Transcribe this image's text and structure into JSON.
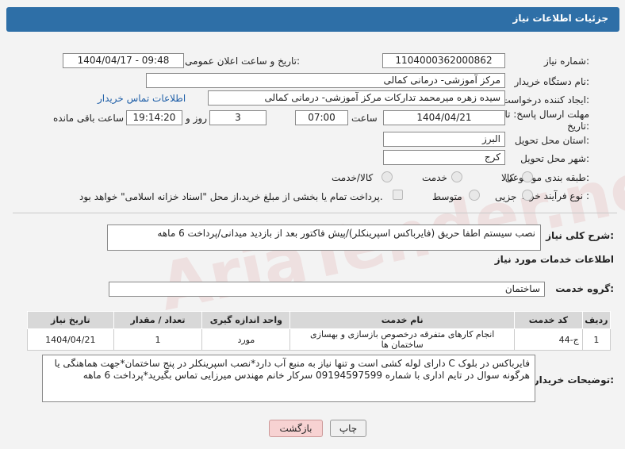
{
  "header": {
    "title": "جزئیات اطلاعات نیاز"
  },
  "fields": {
    "need_number_label": "شماره نیاز:",
    "need_number": "1104000362000862",
    "announce_label": "تاریخ و ساعت اعلان عمومی:",
    "announce_value": "1404/04/17 - 09:48",
    "buyer_org_label": "نام دستگاه خریدار:",
    "buyer_org": "مرکز آموزشی- درمانی کمالی",
    "creator_label": "ایجاد کننده درخواست:",
    "creator": "سیده زهره میرمحمد تدارکات مرکز آموزشی- درمانی کمالی",
    "buyer_contact_link": "اطلاعات تماس خریدار",
    "deadline_label_1": "مهلت ارسال پاسخ: تا",
    "deadline_label_2": "تاریخ:",
    "deadline_date": "1404/04/21",
    "time_label": "ساعت",
    "deadline_time": "07:00",
    "days_value": "3",
    "days_label": "روز و",
    "remaining_time": "19:14:20",
    "remaining_label": "ساعت باقی مانده",
    "province_label": "استان محل تحویل:",
    "province": "البرز",
    "city_label": "شهر محل تحویل:",
    "city": "کرج",
    "category_label": "طبقه بندی موضوعی:",
    "category_options": [
      "کالا",
      "خدمت",
      "کالا/خدمت"
    ],
    "process_label": "نوع فرآیند خرید :",
    "process_options": [
      "جزیی",
      "متوسط"
    ],
    "payment_note": "پرداخت تمام یا بخشی از مبلغ خرید،از محل \"اسناد خزانه اسلامی\" خواهد بود."
  },
  "summary": {
    "label": "شرح کلی نیاز:",
    "text": "نصب سیستم اطفا حریق (فایرباکس اسپرینکلر)/پیش فاکتور بعد از بازدید میدانی/پرداخت 6 ماهه"
  },
  "services": {
    "section_title": "اطلاعات خدمات مورد نیاز",
    "group_label": "گروه خدمت:",
    "group_value": "ساختمان",
    "columns": [
      "ردیف",
      "کد خدمت",
      "نام خدمت",
      "واحد اندازه گیری",
      "تعداد / مقدار",
      "تاریخ نیاز"
    ],
    "rows": [
      [
        "1",
        "ج-44",
        "انجام کارهای متفرقه درخصوص بازسازی و بهسازی ساختمان ها",
        "مورد",
        "1",
        "1404/04/21"
      ]
    ]
  },
  "buyer_notes": {
    "label": "توضیحات خریدار:",
    "text": "فایرباکس در بلوک C دارای لوله کشی است و تنها نیاز به منبع آب دارد*نصب اسپرینکلر در پنج ساختمان*جهت هماهنگی یا هرگونه سوال در تایم اداری با شماره 09194597599 سرکار خانم مهندس میرزایی تماس بگیرید*پرداخت 6 ماهه"
  },
  "buttons": {
    "print": "چاپ",
    "back": "بازگشت"
  },
  "watermark": "AriaTender.neT",
  "colors": {
    "header": "#2e6fa7",
    "link": "#1f5fa8",
    "back_button": "#f7d2d2"
  }
}
